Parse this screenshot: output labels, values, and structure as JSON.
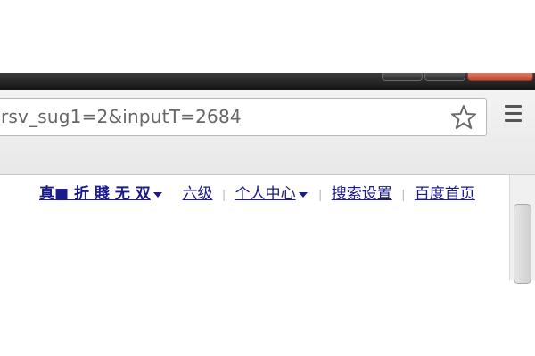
{
  "browser": {
    "address_bar": {
      "url": "rsv_sug1=2&inputT=2684"
    },
    "bookmark_icon": "star-outline-icon",
    "menu_icon": "hamburger-menu-icon"
  },
  "page": {
    "top_nav": {
      "user_name": "真■ 折 賤 无 双",
      "links": [
        "六级",
        "个人中心",
        "搜索设置",
        "百度首页"
      ]
    }
  },
  "colors": {
    "link": "#1a1a8c",
    "titlebar": "#141414",
    "close_button": "#c24a32",
    "toolbar": "#e8e8e8"
  }
}
